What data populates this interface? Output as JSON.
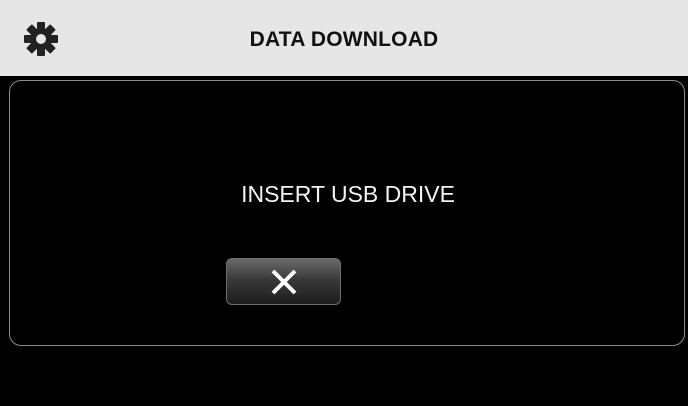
{
  "header": {
    "title": "DATA DOWNLOAD",
    "settings_icon": "gear-icon"
  },
  "dialog": {
    "message": "INSERT USB DRIVE",
    "close_icon": "close-icon"
  },
  "colors": {
    "header_background": "#e6e6e6",
    "screen_background": "#000000",
    "panel_border": "#8c8c8c",
    "text_light": "#f2f2f2",
    "text_dark": "#111111"
  }
}
